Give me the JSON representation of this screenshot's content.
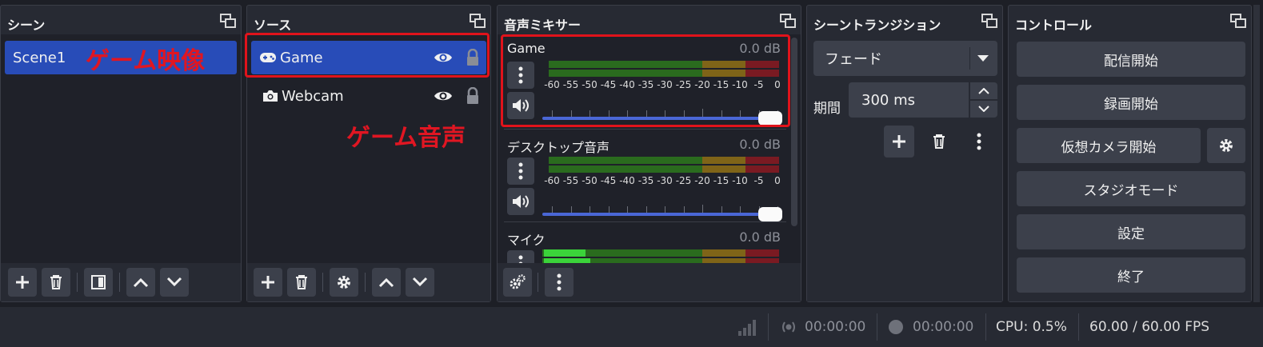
{
  "scenes": {
    "title": "シーン",
    "items": [
      "Scene1"
    ],
    "annotation": "ゲーム映像"
  },
  "sources": {
    "title": "ソース",
    "items": [
      {
        "name": "Game",
        "icon": "gamepad-icon",
        "selected": true
      },
      {
        "name": "Webcam",
        "icon": "camera-icon",
        "selected": false
      }
    ],
    "annotation": "ゲーム音声"
  },
  "mixer": {
    "title": "音声ミキサー",
    "scale": [
      "-60",
      "-55",
      "-50",
      "-45",
      "-40",
      "-35",
      "-30",
      "-25",
      "-20",
      "-15",
      "-10",
      "-5",
      "0"
    ],
    "channels": [
      {
        "name": "Game",
        "db": "0.0 dB"
      },
      {
        "name": "デスクトップ音声",
        "db": "0.0 dB"
      },
      {
        "name": "マイク",
        "db": "0.0 dB"
      }
    ]
  },
  "transitions": {
    "title": "シーントランジション",
    "selected": "フェード",
    "duration_label": "期間",
    "duration_value": "300 ms"
  },
  "controls": {
    "title": "コントロール",
    "start_streaming": "配信開始",
    "start_recording": "録画開始",
    "start_virtualcam": "仮想カメラ開始",
    "studio_mode": "スタジオモード",
    "settings": "設定",
    "exit": "終了"
  },
  "status": {
    "stream_time": "00:00:00",
    "record_time": "00:00:00",
    "cpu": "CPU: 0.5%",
    "fps": "60.00 / 60.00 FPS"
  },
  "colors": {
    "accent": "#284cb8",
    "annotation_red": "#e01622",
    "meter_green": "#2a6b1e",
    "meter_yellow": "#7f6418",
    "meter_red": "#7a1a22"
  }
}
